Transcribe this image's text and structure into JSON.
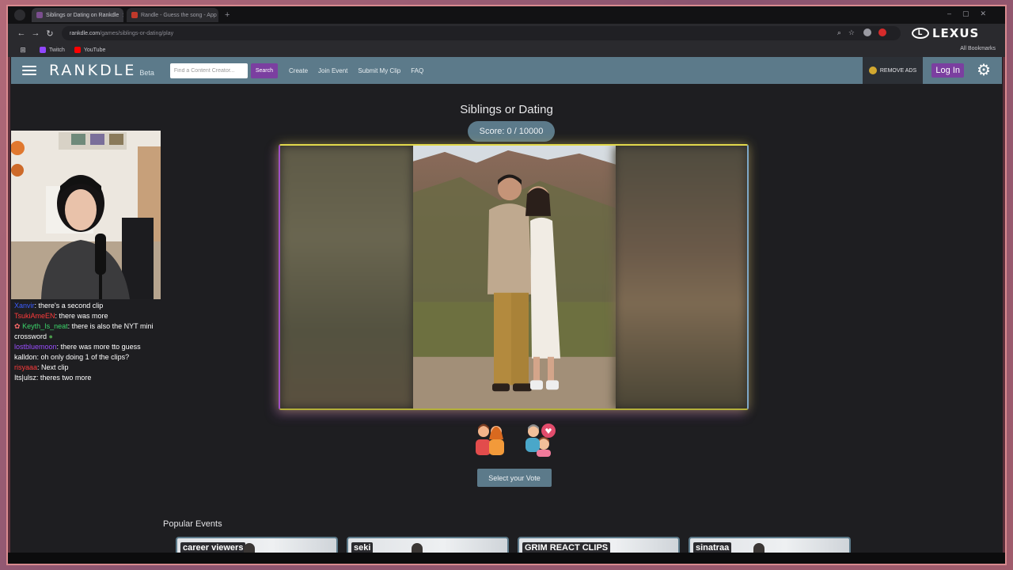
{
  "browser": {
    "tabs": [
      {
        "title": "Siblings or Dating on Rankdle",
        "active": true
      },
      {
        "title": "Randle - Guess the song - App",
        "active": false
      }
    ],
    "url_host": "rankdle.com",
    "url_path": "/games/siblings-or-dating/play",
    "bookmarks": [
      "Twitch",
      "YouTube"
    ],
    "all_bookmarks": "All Bookmarks",
    "ad_brand": "LEXUS"
  },
  "navbar": {
    "logo": "RANKDLE",
    "beta": "Beta",
    "search_placeholder": "Find a Content Creator...",
    "search_button": "Search",
    "links": [
      "Create",
      "Join Event",
      "Submit My Clip",
      "FAQ"
    ],
    "remove_ads": "REMOVE ADS",
    "login": "Log In"
  },
  "game": {
    "title": "Siblings or Dating",
    "score": "Score: 0 / 10000",
    "vote_button": "Select your Vote",
    "vote_options": [
      "siblings-icon",
      "dating-icon"
    ]
  },
  "popular": {
    "title": "Popular Events",
    "events": [
      "career viewers",
      "seki",
      "GRIM REACT CLIPS",
      "sinatraa"
    ]
  },
  "chat": [
    {
      "user": "Xanvir",
      "message": "there's a second clip",
      "color": "#3b5cff"
    },
    {
      "user": "TsukiAmeEN",
      "message": "there was more",
      "color": "#ff3b3b"
    },
    {
      "user": "Keyth_Is_neat",
      "message": "there is also the NYT mini crossword",
      "color": "#3bd46a"
    },
    {
      "user": "lostbluemoon",
      "message": "there was more tto guess",
      "color": "#9a4dff"
    },
    {
      "user": "kalldon",
      "message": "oh only doing 1 of the clips?",
      "color": "#ffffff"
    },
    {
      "user": "risyaaa",
      "message": "Next clip",
      "color": "#ff3b3b"
    },
    {
      "user": "Its|ulsz",
      "message": "theres two more",
      "color": "#ffffff"
    }
  ],
  "colors": {
    "nav_bg": "#5c7a8a",
    "accent_purple": "#7b3fa0",
    "page_bg": "#1e1e21"
  }
}
